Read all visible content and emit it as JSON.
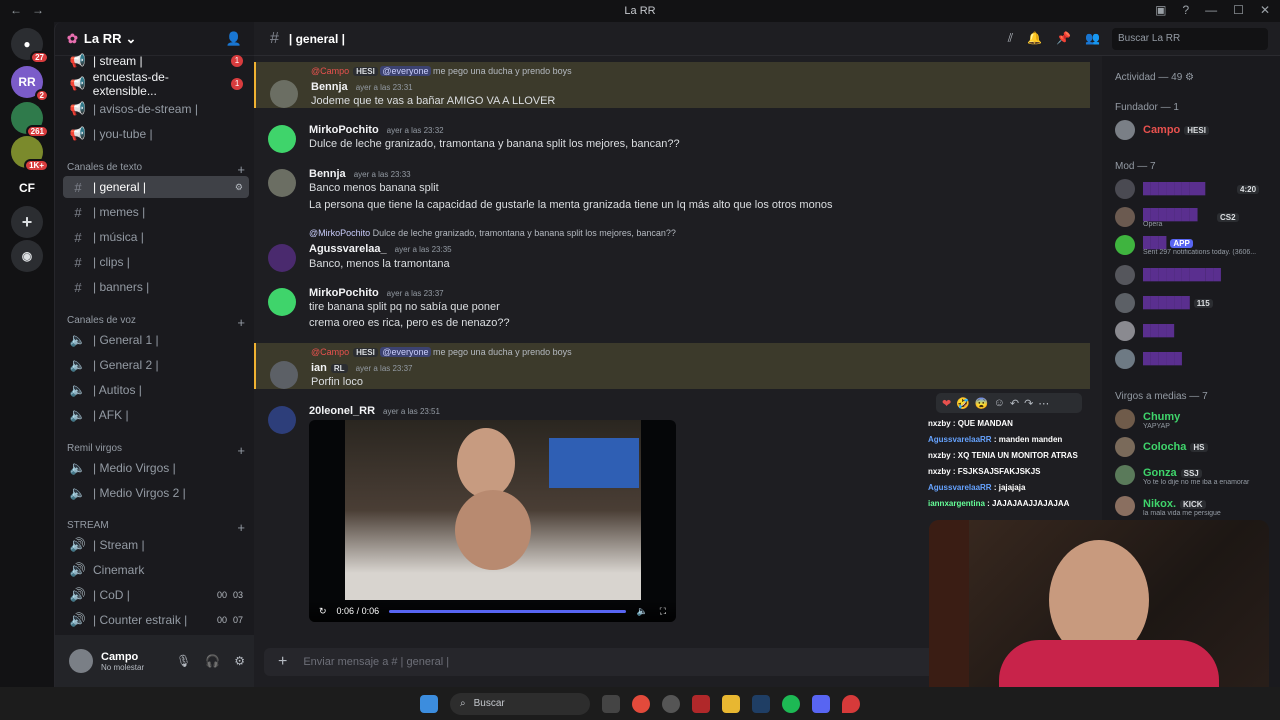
{
  "window": {
    "title": "La RR"
  },
  "servers": [
    {
      "label": "",
      "badge": "27"
    },
    {
      "label": "RR",
      "badge": "2"
    },
    {
      "label": "",
      "badge": "261"
    },
    {
      "label": "",
      "badge": "1K+"
    },
    {
      "label": "CF",
      "badge": ""
    }
  ],
  "guild": {
    "name": "La RR"
  },
  "channels_top": [
    {
      "name": "| stream |",
      "count": "1"
    },
    {
      "name": "encuestas-de-extensible...",
      "count": "1"
    },
    {
      "name": "| avisos-de-stream |",
      "count": ""
    },
    {
      "name": "| you-tube |",
      "count": ""
    }
  ],
  "categories": {
    "text": "Canales de texto",
    "voice": "Canales de voz",
    "remil": "Remil virgos",
    "stream": "STREAM"
  },
  "text_channels": [
    "| general |",
    "| memes |",
    "| música |",
    "| clips |",
    "| banners |"
  ],
  "voice_channels": [
    "| General 1 |",
    "| General 2 |",
    "| Autitos |",
    "| AFK |"
  ],
  "remil_channels": [
    "| Medio Virgos |",
    "| Medio Virgos 2 |"
  ],
  "stream_channels": [
    {
      "name": "| Stream |",
      "v1": "",
      "v2": ""
    },
    {
      "name": "Cinemark",
      "v1": "",
      "v2": ""
    },
    {
      "name": "| CoD |",
      "v1": "00",
      "v2": "03"
    },
    {
      "name": "| Counter estraik |",
      "v1": "00",
      "v2": "07"
    }
  ],
  "user": {
    "name": "Campo",
    "status": "No molestar"
  },
  "header": {
    "channel": "| general |",
    "search_placeholder": "Buscar La RR"
  },
  "messages": [
    {
      "reply_user": "@Campo",
      "reply_chip": "HESI",
      "reply_mention": "@everyone",
      "reply_text": "me pego una ducha y prendo boys",
      "author": "Bennja",
      "time": "ayer a las 23:31",
      "lines": [
        "Jodeme que te vas a bañar AMIGO VA A LLOVER"
      ]
    },
    {
      "author": "MirkoPochito",
      "time": "ayer a las 23:32",
      "lines": [
        "Dulce de leche granizado, tramontana y banana split los mejores, bancan??"
      ]
    },
    {
      "author": "Bennja",
      "time": "ayer a las 23:33",
      "lines": [
        "Banco menos banana split",
        "La persona que tiene la capacidad de gustarle la menta granizada tiene un Iq más alto que los otros monos"
      ]
    },
    {
      "reply_user": "@MirkoPochito",
      "reply_text": "Dulce de leche granizado, tramontana y banana split los mejores, bancan??",
      "author": "Agussvarelaa_",
      "time": "ayer a las 23:35",
      "lines": [
        "Banco, menos la tramontana"
      ]
    },
    {
      "author": "MirkoPochito",
      "time": "ayer a las 23:37",
      "lines": [
        "tire banana split pq no sabía que poner",
        "crema oreo es rica, pero es de nenazo??"
      ]
    },
    {
      "reply_user": "@Campo",
      "reply_chip": "HESI",
      "reply_mention": "@everyone",
      "reply_text": "me pego una ducha y prendo boys",
      "author": "ian",
      "author_chip": "RL",
      "time": "ayer a las 23:37",
      "lines": [
        "Porfin loco"
      ]
    },
    {
      "author": "20leonel_RR",
      "time": "ayer a las 23:51",
      "lines": []
    }
  ],
  "video": {
    "time": "0:06 / 0:06",
    "progress": 1.0
  },
  "composer": {
    "placeholder": "Enviar mensaje a # | general |"
  },
  "members": {
    "activity": "Actividad — 49",
    "groups": [
      {
        "title": "Fundador — 1",
        "items": [
          {
            "name": "Campo",
            "chip": "HESI",
            "sub": "",
            "color": "#e8514e"
          }
        ]
      },
      {
        "title": "Mod — 7",
        "items": [
          {
            "name": "",
            "chip": "4:20",
            "sub": "",
            "color": "#5a2f8f"
          },
          {
            "name": "",
            "chip": "CS2",
            "sub": "Opera",
            "color": "#5a2f8f"
          },
          {
            "name": "",
            "chip": "APP",
            "sub": "Sent 297 notifications today. (3606...",
            "color": "#5a2f8f"
          },
          {
            "name": "",
            "chip": "",
            "sub": "",
            "color": "#5a2f8f"
          },
          {
            "name": "",
            "chip": "115",
            "sub": "",
            "color": "#5a2f8f"
          },
          {
            "name": "",
            "chip": "",
            "sub": "",
            "color": "#5a2f8f"
          },
          {
            "name": "",
            "chip": "",
            "sub": "",
            "color": "#5a2f8f"
          }
        ]
      },
      {
        "title": "Virgos a medias — 7",
        "items": [
          {
            "name": "Chumy",
            "chip": "",
            "sub": "YAPYAP",
            "color": "#3fd46b"
          },
          {
            "name": "Colocha",
            "chip": "HS",
            "sub": "",
            "color": "#3fd46b"
          },
          {
            "name": "Gonza",
            "chip": "SSJ",
            "sub": "Yo te lo dije no me iba a enamorar",
            "color": "#3fd46b"
          },
          {
            "name": "Nikox.",
            "chip": "KICK",
            "sub": "la mala vida me persigue",
            "color": "#3fd46b"
          }
        ]
      }
    ]
  },
  "twitch_chat": [
    {
      "user": "nxzby",
      "text": ": QUE MANDAN",
      "cls": "u1"
    },
    {
      "user": "AgussvarelaaRR",
      "text": ": manden manden",
      "cls": "u2"
    },
    {
      "user": "nxzby",
      "text": ": XQ TENIA UN MONITOR ATRAS",
      "cls": "u1"
    },
    {
      "user": "nxzby",
      "text": ": FSJKSAJSFAKJSKJS",
      "cls": "u1"
    },
    {
      "user": "AgussvarelaaRR",
      "text": ": jajajaja",
      "cls": "u2"
    },
    {
      "user": "iannxargentina",
      "text": ": JAJAJAAJJAJAJAA",
      "cls": "u3"
    }
  ],
  "taskbar": {
    "search": "Buscar"
  },
  "colors": {
    "accent": "#5865f2",
    "mention": "#f0b232",
    "dnd": "#d83c3e"
  }
}
